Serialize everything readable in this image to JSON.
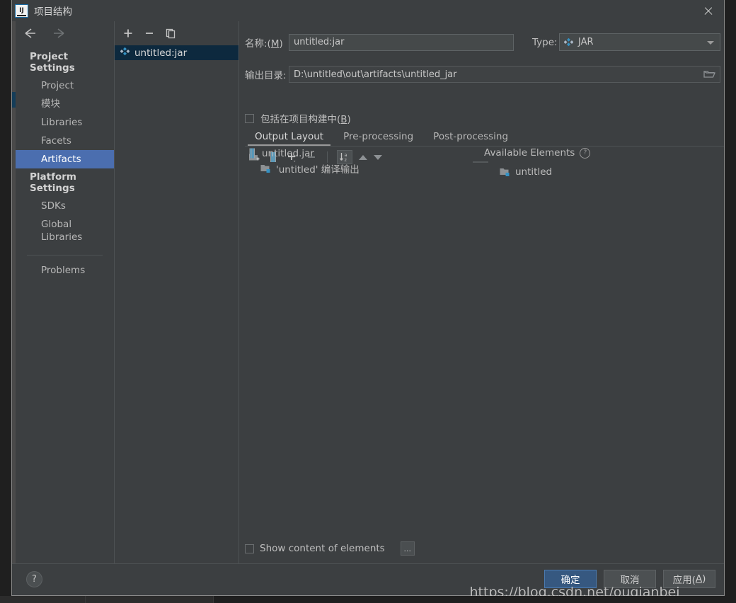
{
  "window": {
    "title": "项目结构",
    "app_icon": "intellij-idea-icon",
    "close_icon": "close-icon"
  },
  "sidebar": {
    "back_icon": "arrow-left-icon",
    "forward_icon": "arrow-right-icon",
    "sections": [
      {
        "heading": "Project Settings",
        "items": [
          {
            "label": "Project",
            "selected": false
          },
          {
            "label": "模块",
            "selected": false
          },
          {
            "label": "Libraries",
            "selected": false
          },
          {
            "label": "Facets",
            "selected": false
          },
          {
            "label": "Artifacts",
            "selected": true
          }
        ]
      },
      {
        "heading": "Platform Settings",
        "items": [
          {
            "label": "SDKs",
            "selected": false
          },
          {
            "label": "Global Libraries",
            "selected": false
          }
        ]
      }
    ],
    "problems": "Problems"
  },
  "artifact_panel": {
    "toolbar": [
      {
        "name": "add-icon",
        "glyph": "+"
      },
      {
        "name": "remove-icon",
        "glyph": "−"
      },
      {
        "name": "copy-icon",
        "glyph": "copy"
      }
    ],
    "items": [
      {
        "label": "untitled:jar",
        "icon": "artifact-jar-icon",
        "selected": true
      }
    ]
  },
  "form": {
    "name_label": "名称:(M)",
    "name_mnemonic": "M",
    "name_value": "untitled:jar",
    "type_label": "Type:",
    "type_value": "JAR",
    "type_icon": "artifact-jar-icon",
    "output_dir_label": "输出目录:",
    "output_dir_value": "D:\\untitled\\out\\artifacts\\untitled_jar",
    "browse_icon": "folder-open-icon",
    "include_build_label": "包括在项目构建中(B)",
    "include_build_mnemonic": "B",
    "include_build_checked": false
  },
  "tabs": [
    {
      "label": "Output Layout",
      "active": true
    },
    {
      "label": "Pre-processing",
      "active": false
    },
    {
      "label": "Post-processing",
      "active": false
    }
  ],
  "content_toolbar": [
    {
      "name": "add-directory-icon",
      "glyph": "folder-plus"
    },
    {
      "name": "add-archive-icon",
      "glyph": "archive"
    },
    {
      "name": "add-element-icon",
      "glyph": "+"
    },
    {
      "name": "remove-element-icon",
      "glyph": "−"
    },
    {
      "name": "sort-az-icon",
      "glyph": "sort"
    },
    {
      "name": "move-up-icon",
      "glyph": "up"
    },
    {
      "name": "move-down-icon",
      "glyph": "down"
    }
  ],
  "output_tree": [
    {
      "label": "untitled.jar",
      "icon": "archive-icon",
      "depth": 0
    },
    {
      "label": "'untitled' 编译输出",
      "icon": "compile-output-icon",
      "depth": 1
    }
  ],
  "available": {
    "heading": "Available Elements",
    "help_icon": "help-icon",
    "items": [
      {
        "label": "untitled",
        "icon": "module-output-icon",
        "depth": 0
      }
    ]
  },
  "bottom_options": {
    "show_content_label": "Show content of elements",
    "show_content_checked": false,
    "more_label": "..."
  },
  "footer": {
    "help_glyph": "?",
    "buttons": [
      {
        "label": "确定",
        "primary": true,
        "name": "ok-button"
      },
      {
        "label": "取消",
        "primary": false,
        "name": "cancel-button"
      },
      {
        "label": "应用(A)",
        "primary": false,
        "name": "apply-button"
      }
    ]
  },
  "watermark": "https://blog.csdn.net/ouqianbei",
  "colors": {
    "background": "#3c3f41",
    "selection": "#4b6eaf",
    "list_selection": "#0d293e",
    "primary_button": "#365880",
    "accent": "#3592c4",
    "text": "#bbbbbb"
  }
}
